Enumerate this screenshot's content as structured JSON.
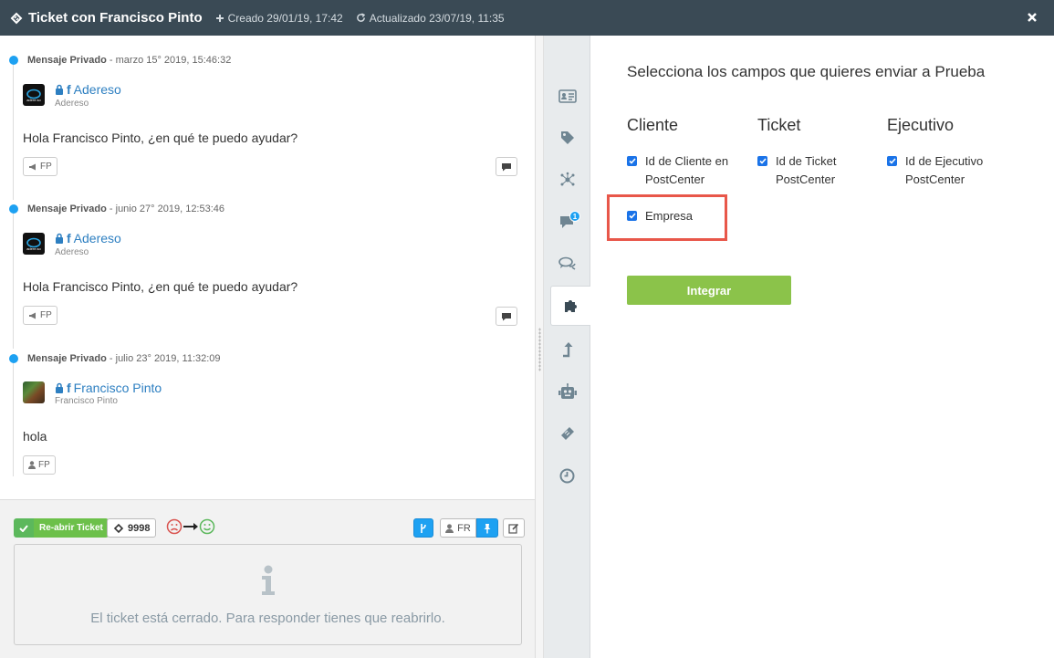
{
  "header": {
    "title": "Ticket con Francisco Pinto",
    "created": "Creado 29/01/19, 17:42",
    "updated": "Actualizado 23/07/19, 11:35"
  },
  "messages": [
    {
      "type": "Mensaje Privado",
      "date": "marzo 15° 2019, 15:46:32",
      "author": "Adereso",
      "author_sub": "Adereso",
      "avatar_text": "adere.so",
      "text": "Hola Francisco Pinto, ¿en qué te puedo ayudar?",
      "tag": "FP"
    },
    {
      "type": "Mensaje Privado",
      "date": "junio 27° 2019, 12:53:46",
      "author": "Adereso",
      "author_sub": "Adereso",
      "avatar_text": "adere.so",
      "text": "Hola Francisco Pinto, ¿en qué te puedo ayudar?",
      "tag": "FP"
    },
    {
      "type": "Mensaje Privado",
      "date": "julio 23° 2019, 11:32:09",
      "author": "Francisco Pinto",
      "author_sub": "Francisco Pinto",
      "text": "hola",
      "tag": "FP"
    }
  ],
  "composer": {
    "reopen_label": "Re-abrir Ticket",
    "ticket_number": "9998",
    "assignee": "FR",
    "closed_message": "El ticket está cerrado. Para responder tienes que reabrirlo."
  },
  "rail": {
    "chat_badge": "1"
  },
  "integration": {
    "title": "Selecciona los campos que quieres enviar a Prueba",
    "columns": [
      {
        "title": "Cliente",
        "fields": [
          "Id de Cliente en PostCenter",
          "Empresa"
        ]
      },
      {
        "title": "Ticket",
        "fields": [
          "Id de Ticket PostCenter"
        ]
      },
      {
        "title": "Ejecutivo",
        "fields": [
          "Id de Ejecutivo PostCenter"
        ]
      }
    ],
    "button_label": "Integrar"
  },
  "colors": {
    "topbar": "#3a4a55",
    "accent_blue": "#1da1f2",
    "link_blue": "#2d7fc1",
    "green_button": "#8bc34a",
    "highlight_red": "#e8574a"
  }
}
